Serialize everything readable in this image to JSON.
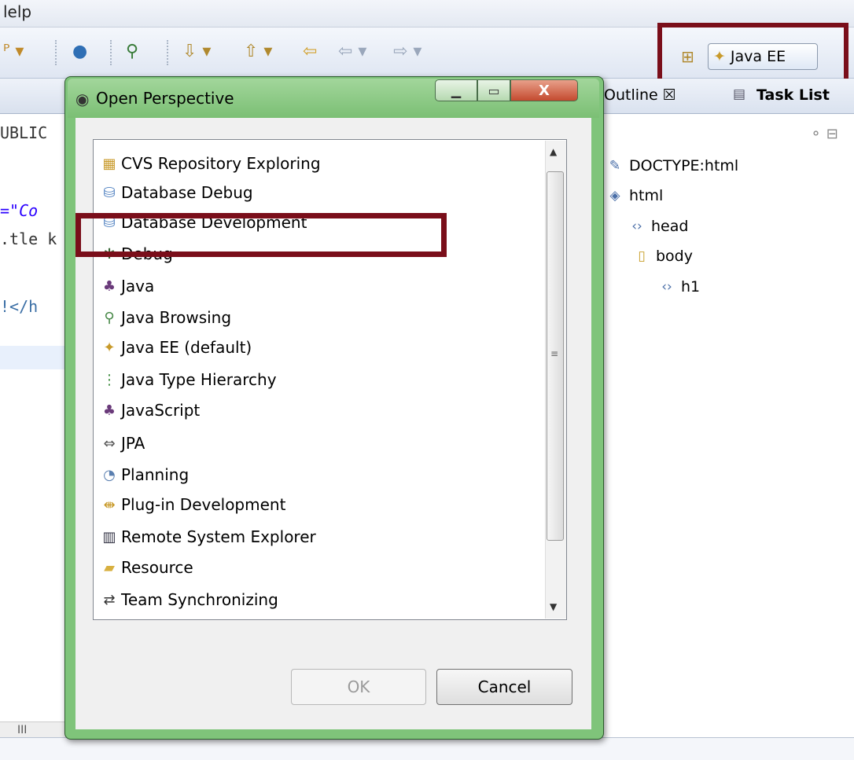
{
  "menubar": {
    "help_label": "lelp"
  },
  "toolbar": {
    "perspective_button_label": "Java EE"
  },
  "editor": {
    "tab_text": "UBLIC",
    "code_lines": [
      "=\"Co",
      ".tle k",
      "!</h"
    ],
    "hscroll_label": "III"
  },
  "outline": {
    "tabs": [
      {
        "label": "Outline ☒"
      },
      {
        "label": "Task List"
      }
    ],
    "tree": [
      {
        "label": "DOCTYPE:html",
        "icon": "doctype-icon"
      },
      {
        "label": "html",
        "icon": "html-tag-icon"
      },
      {
        "label": "head",
        "icon": "element-icon"
      },
      {
        "label": "body",
        "icon": "body-icon"
      },
      {
        "label": "h1",
        "icon": "element-icon"
      }
    ]
  },
  "dialog": {
    "title": "Open Perspective",
    "items": [
      {
        "label": "CVS Repository Exploring",
        "icon": "cvs-icon"
      },
      {
        "label": "Database Debug",
        "icon": "database-debug-icon"
      },
      {
        "label": "Database Development",
        "icon": "database-icon"
      },
      {
        "label": "Debug",
        "icon": "bug-icon"
      },
      {
        "label": "Java",
        "icon": "java-icon"
      },
      {
        "label": "Java Browsing",
        "icon": "java-browsing-icon"
      },
      {
        "label": "Java EE (default)",
        "icon": "java-ee-icon"
      },
      {
        "label": "Java Type Hierarchy",
        "icon": "hierarchy-icon"
      },
      {
        "label": "JavaScript",
        "icon": "javascript-icon"
      },
      {
        "label": "JPA",
        "icon": "jpa-icon"
      },
      {
        "label": "Planning",
        "icon": "planning-icon"
      },
      {
        "label": "Plug-in Development",
        "icon": "plugin-icon"
      },
      {
        "label": "Remote System Explorer",
        "icon": "remote-system-icon"
      },
      {
        "label": "Resource",
        "icon": "folder-icon"
      },
      {
        "label": "Team Synchronizing",
        "icon": "team-sync-icon"
      }
    ],
    "ok_label": "OK",
    "cancel_label": "Cancel"
  },
  "colors": {
    "highlight_frame": "#7a0e1a",
    "dialog_frame": "#7fc47a",
    "close_button": "#c44a2f"
  }
}
